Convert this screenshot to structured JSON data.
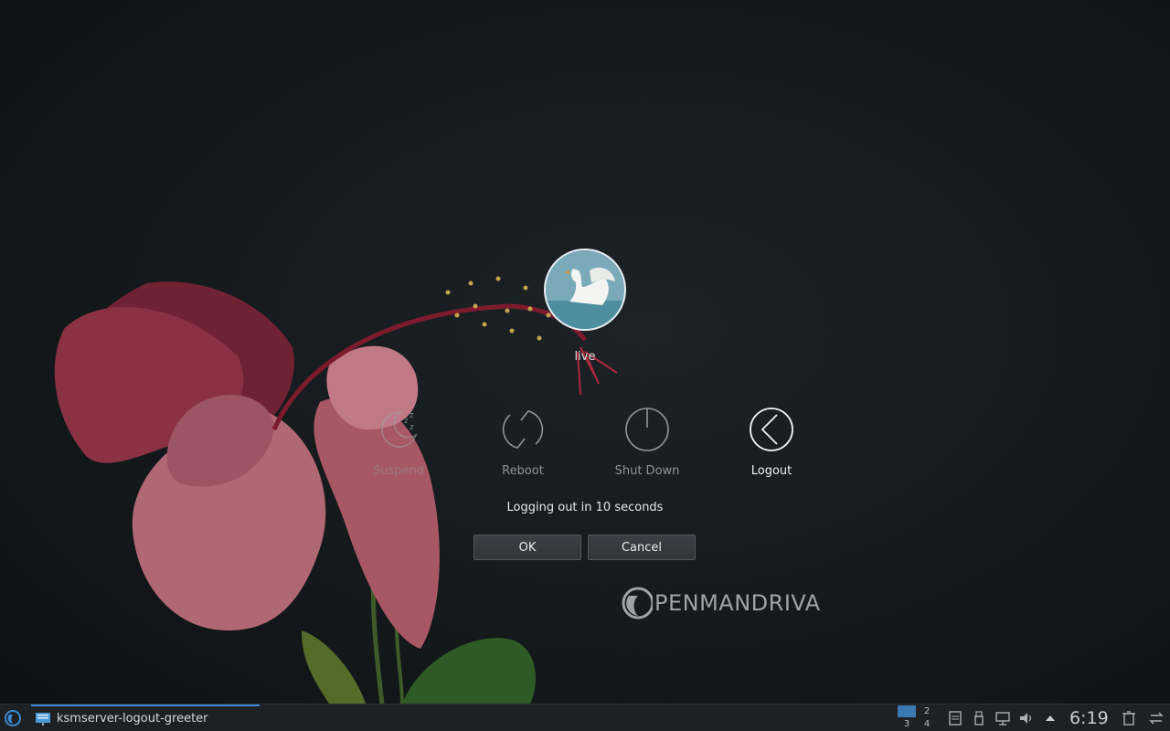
{
  "user": {
    "name": "live"
  },
  "actions": [
    {
      "id": "suspend",
      "label": "Suspend",
      "icon": "sleep-icon"
    },
    {
      "id": "reboot",
      "label": "Reboot",
      "icon": "reboot-icon"
    },
    {
      "id": "shutdown",
      "label": "Shut Down",
      "icon": "power-icon"
    },
    {
      "id": "logout",
      "label": "Logout",
      "icon": "back-arrow-icon",
      "selected": true
    }
  ],
  "status": "Logging out in 10 seconds",
  "buttons": {
    "ok": "OK",
    "cancel": "Cancel"
  },
  "logo": {
    "text": "PENMANDRIVA"
  },
  "taskbar": {
    "task_label": "ksmserver-logout-greeter",
    "pager": [
      "2",
      "3",
      "4"
    ],
    "clock": "6:19"
  },
  "colors": {
    "accent": "#3b8ad1",
    "background": "#14191c",
    "flower": "#9a3c4e"
  }
}
